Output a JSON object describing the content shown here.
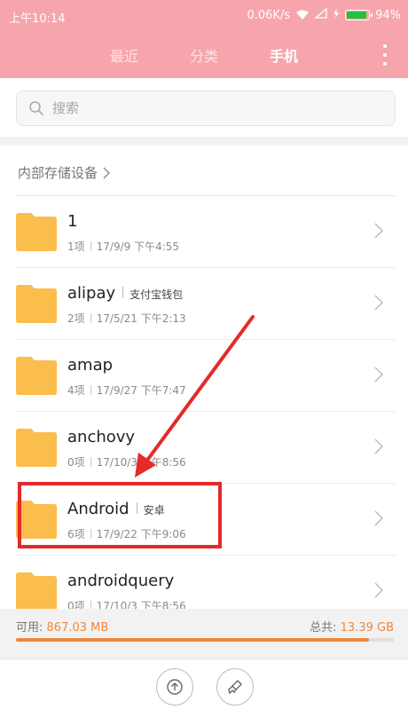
{
  "status_bar": {
    "time": "上午10:14",
    "network_speed": "0.06K/s",
    "battery_text": "94%",
    "battery_level": 0.94
  },
  "tabs": [
    {
      "label": "最近",
      "active": false
    },
    {
      "label": "分类",
      "active": false
    },
    {
      "label": "手机",
      "active": true
    }
  ],
  "search": {
    "placeholder": "搜索"
  },
  "breadcrumb": {
    "label": "内部存储设备"
  },
  "files": [
    {
      "name": "1",
      "tag": "",
      "count": "1项",
      "date": "17/9/9 下午4:55"
    },
    {
      "name": "alipay",
      "tag": "支付宝钱包",
      "count": "2项",
      "date": "17/5/21 下午2:13"
    },
    {
      "name": "amap",
      "tag": "",
      "count": "4项",
      "date": "17/9/27 下午7:47"
    },
    {
      "name": "anchovy",
      "tag": "",
      "count": "0项",
      "date": "17/10/3 下午8:56"
    },
    {
      "name": "Android",
      "tag": "安卓",
      "count": "6项",
      "date": "17/9/22 下午9:06"
    },
    {
      "name": "androidquery",
      "tag": "",
      "count": "0项",
      "date": "17/10/3 下午8:56"
    }
  ],
  "storage": {
    "available_label": "可用:",
    "available_value": "867.03 MB",
    "total_label": "总共:",
    "total_value": "13.39 GB",
    "used_fraction": 0.935
  },
  "colors": {
    "accent_header": "#f6a5ad",
    "folder": "#fbbd4c",
    "highlight": "#e52a2a",
    "storage_fill": "#f0863c"
  },
  "icons": {
    "search": "search-icon",
    "folder": "folder-icon",
    "chevron": "chevron-right-icon",
    "upload": "upload-icon",
    "clean": "brush-icon",
    "menu": "more-vertical-icon"
  }
}
